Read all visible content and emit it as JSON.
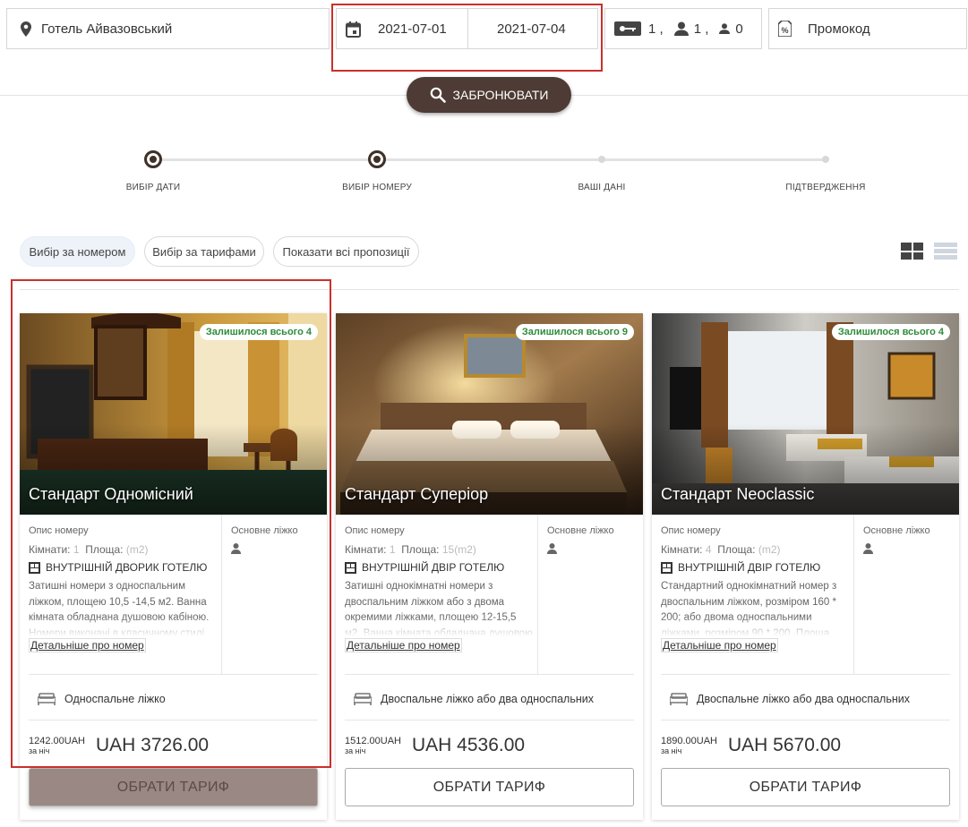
{
  "search": {
    "hotel": "Готель Айвазовський",
    "check_in": "2021-07-01",
    "check_out": "2021-07-04",
    "rooms": "1 ,",
    "adults": "1 ,",
    "children": "0",
    "promo_placeholder": "Промокод",
    "book_label": "ЗАБРОНЮВАТИ"
  },
  "stepper": {
    "steps": [
      {
        "label": "ВИБІР ДАТИ",
        "state": "done"
      },
      {
        "label": "ВИБІР НОМЕРУ",
        "state": "current"
      },
      {
        "label": "ВАШІ ДАНІ",
        "state": "todo"
      },
      {
        "label": "ПІДТВЕРДЖЕННЯ",
        "state": "todo"
      }
    ]
  },
  "filters": {
    "by_room": "Вибір за номером",
    "by_rate": "Вибір за тарифами",
    "show_all": "Показати всі пропозиції"
  },
  "cards": [
    {
      "name": "Стандарт Одномісний",
      "availability": "Залишилося всього 4",
      "desc_label": "Опис номеру",
      "rooms_label": "Кімнати:",
      "rooms_value": "1",
      "area_label": "Площа:",
      "area_value": "(m2)",
      "feature": "ВНУТРІШНІЙ ДВОРИК ГОТЕЛЮ",
      "description": "Затишні номери з односпальним ліжком, площею 10,5 -14,5 м2. Ванна кімната обладнана душовою кабіною. Номери виконані в класичному стилі.",
      "more": "Детальніше про номер",
      "bed_label": "Основне ліжко",
      "bed_type": "Односпальне ліжко",
      "price_night": "1242.00UAH",
      "per_night": "за ніч",
      "price_total": "UAH 3726.00",
      "button": "ОБРАТИ ТАРИФ"
    },
    {
      "name": "Стандарт Суперіор",
      "availability": "Залишилося всього 9",
      "desc_label": "Опис номеру",
      "rooms_label": "Кімнати:",
      "rooms_value": "1",
      "area_label": "Площа:",
      "area_value": "15(m2)",
      "feature": "ВНУТРІШНІЙ ДВІР ГОТЕЛЮ",
      "description": "Затишні однокімнатні номери з двоспальним ліжком або з двома окремими ліжками, площею 12-15,5 м2. Ванна кімната обладнана душовою",
      "more": "Детальніше про номер",
      "bed_label": "Основне ліжко",
      "bed_type": "Двоспальне ліжко або два односпальних",
      "price_night": "1512.00UAH",
      "per_night": "за ніч",
      "price_total": "UAH 4536.00",
      "button": "ОБРАТИ ТАРИФ"
    },
    {
      "name": "Стандарт Neoclassic",
      "availability": "Залишилося всього 4",
      "desc_label": "Опис номеру",
      "rooms_label": "Кімнати:",
      "rooms_value": "4",
      "area_label": "Площа:",
      "area_value": "(m2)",
      "feature": "ВНУТРІШНІЙ ДВІР ГОТЕЛЮ",
      "description": "Стандартний однокімнатний номер з двоспальним ліжком, розміром 160 * 200; або двома односпальними ліжками, розміром 90 * 200. Площа",
      "more": "Детальніше про номер",
      "bed_label": "Основне ліжко",
      "bed_type": "Двоспальне ліжко або два односпальних",
      "price_night": "1890.00UAH",
      "per_night": "за ніч",
      "price_total": "UAH 5670.00",
      "button": "ОБРАТИ ТАРИФ"
    }
  ],
  "colors": {
    "brand": "#4e3b35",
    "availability": "#2e8b3a",
    "highlight_frame": "#c9302c"
  }
}
